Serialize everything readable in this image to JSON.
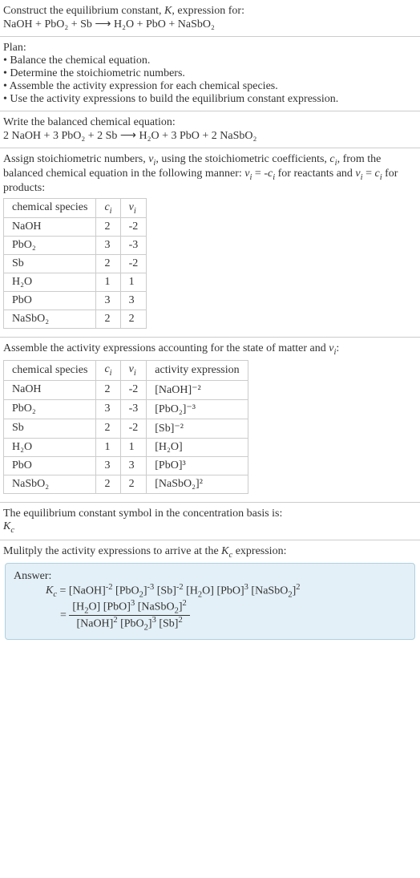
{
  "s1": {
    "line1": "Construct the equilibrium constant, K, expression for:",
    "line2": "NaOH + PbO₂ + Sb ⟶ H₂O + PbO + NaSbO₂"
  },
  "s2": {
    "title": "Plan:",
    "b1": "• Balance the chemical equation.",
    "b2": "• Determine the stoichiometric numbers.",
    "b3": "• Assemble the activity expression for each chemical species.",
    "b4": "• Use the activity expressions to build the equilibrium constant expression."
  },
  "s3": {
    "line1": "Write the balanced chemical equation:",
    "line2": "2 NaOH + 3 PbO₂ + 2 Sb ⟶ H₂O + 3 PbO + 2 NaSbO₂"
  },
  "s4": {
    "intro1": "Assign stoichiometric numbers, νᵢ, using the stoichiometric coefficients, cᵢ, from the balanced chemical equation in the following manner: νᵢ = -cᵢ for reactants and νᵢ = cᵢ for products:",
    "h1": "chemical species",
    "h2": "cᵢ",
    "h3": "νᵢ",
    "rows": [
      {
        "sp": "NaOH",
        "c": "2",
        "v": "-2"
      },
      {
        "sp": "PbO₂",
        "c": "3",
        "v": "-3"
      },
      {
        "sp": "Sb",
        "c": "2",
        "v": "-2"
      },
      {
        "sp": "H₂O",
        "c": "1",
        "v": "1"
      },
      {
        "sp": "PbO",
        "c": "3",
        "v": "3"
      },
      {
        "sp": "NaSbO₂",
        "c": "2",
        "v": "2"
      }
    ]
  },
  "s5": {
    "intro": "Assemble the activity expressions accounting for the state of matter and νᵢ:",
    "h1": "chemical species",
    "h2": "cᵢ",
    "h3": "νᵢ",
    "h4": "activity expression",
    "rows": [
      {
        "sp": "NaOH",
        "c": "2",
        "v": "-2",
        "a": "[NaOH]⁻²"
      },
      {
        "sp": "PbO₂",
        "c": "3",
        "v": "-3",
        "a": "[PbO₂]⁻³"
      },
      {
        "sp": "Sb",
        "c": "2",
        "v": "-2",
        "a": "[Sb]⁻²"
      },
      {
        "sp": "H₂O",
        "c": "1",
        "v": "1",
        "a": "[H₂O]"
      },
      {
        "sp": "PbO",
        "c": "3",
        "v": "3",
        "a": "[PbO]³"
      },
      {
        "sp": "NaSbO₂",
        "c": "2",
        "v": "2",
        "a": "[NaSbO₂]²"
      }
    ]
  },
  "s6": {
    "line1": "The equilibrium constant symbol in the concentration basis is:",
    "line2": "K𝒸"
  },
  "s7": {
    "line1": "Mulitply the activity expressions to arrive at the K𝒸 expression:"
  },
  "ans": {
    "title": "Answer:",
    "eq1": "K𝒸 = [NaOH]⁻² [PbO₂]⁻³ [Sb]⁻² [H₂O] [PbO]³ [NaSbO₂]²",
    "eq2_lead": "= ",
    "eq2_num": "[H₂O] [PbO]³ [NaSbO₂]²",
    "eq2_den": "[NaOH]² [PbO₂]³ [Sb]²"
  },
  "chart_data": {
    "type": "table",
    "table1": {
      "columns": [
        "chemical species",
        "cᵢ",
        "νᵢ"
      ],
      "rows": [
        [
          "NaOH",
          2,
          -2
        ],
        [
          "PbO₂",
          3,
          -3
        ],
        [
          "Sb",
          2,
          -2
        ],
        [
          "H₂O",
          1,
          1
        ],
        [
          "PbO",
          3,
          3
        ],
        [
          "NaSbO₂",
          2,
          2
        ]
      ]
    },
    "table2": {
      "columns": [
        "chemical species",
        "cᵢ",
        "νᵢ",
        "activity expression"
      ],
      "rows": [
        [
          "NaOH",
          2,
          -2,
          "[NaOH]^-2"
        ],
        [
          "PbO₂",
          3,
          -3,
          "[PbO₂]^-3"
        ],
        [
          "Sb",
          2,
          -2,
          "[Sb]^-2"
        ],
        [
          "H₂O",
          1,
          1,
          "[H₂O]"
        ],
        [
          "PbO",
          3,
          3,
          "[PbO]^3"
        ],
        [
          "NaSbO₂",
          2,
          2,
          "[NaSbO₂]^2"
        ]
      ]
    }
  }
}
